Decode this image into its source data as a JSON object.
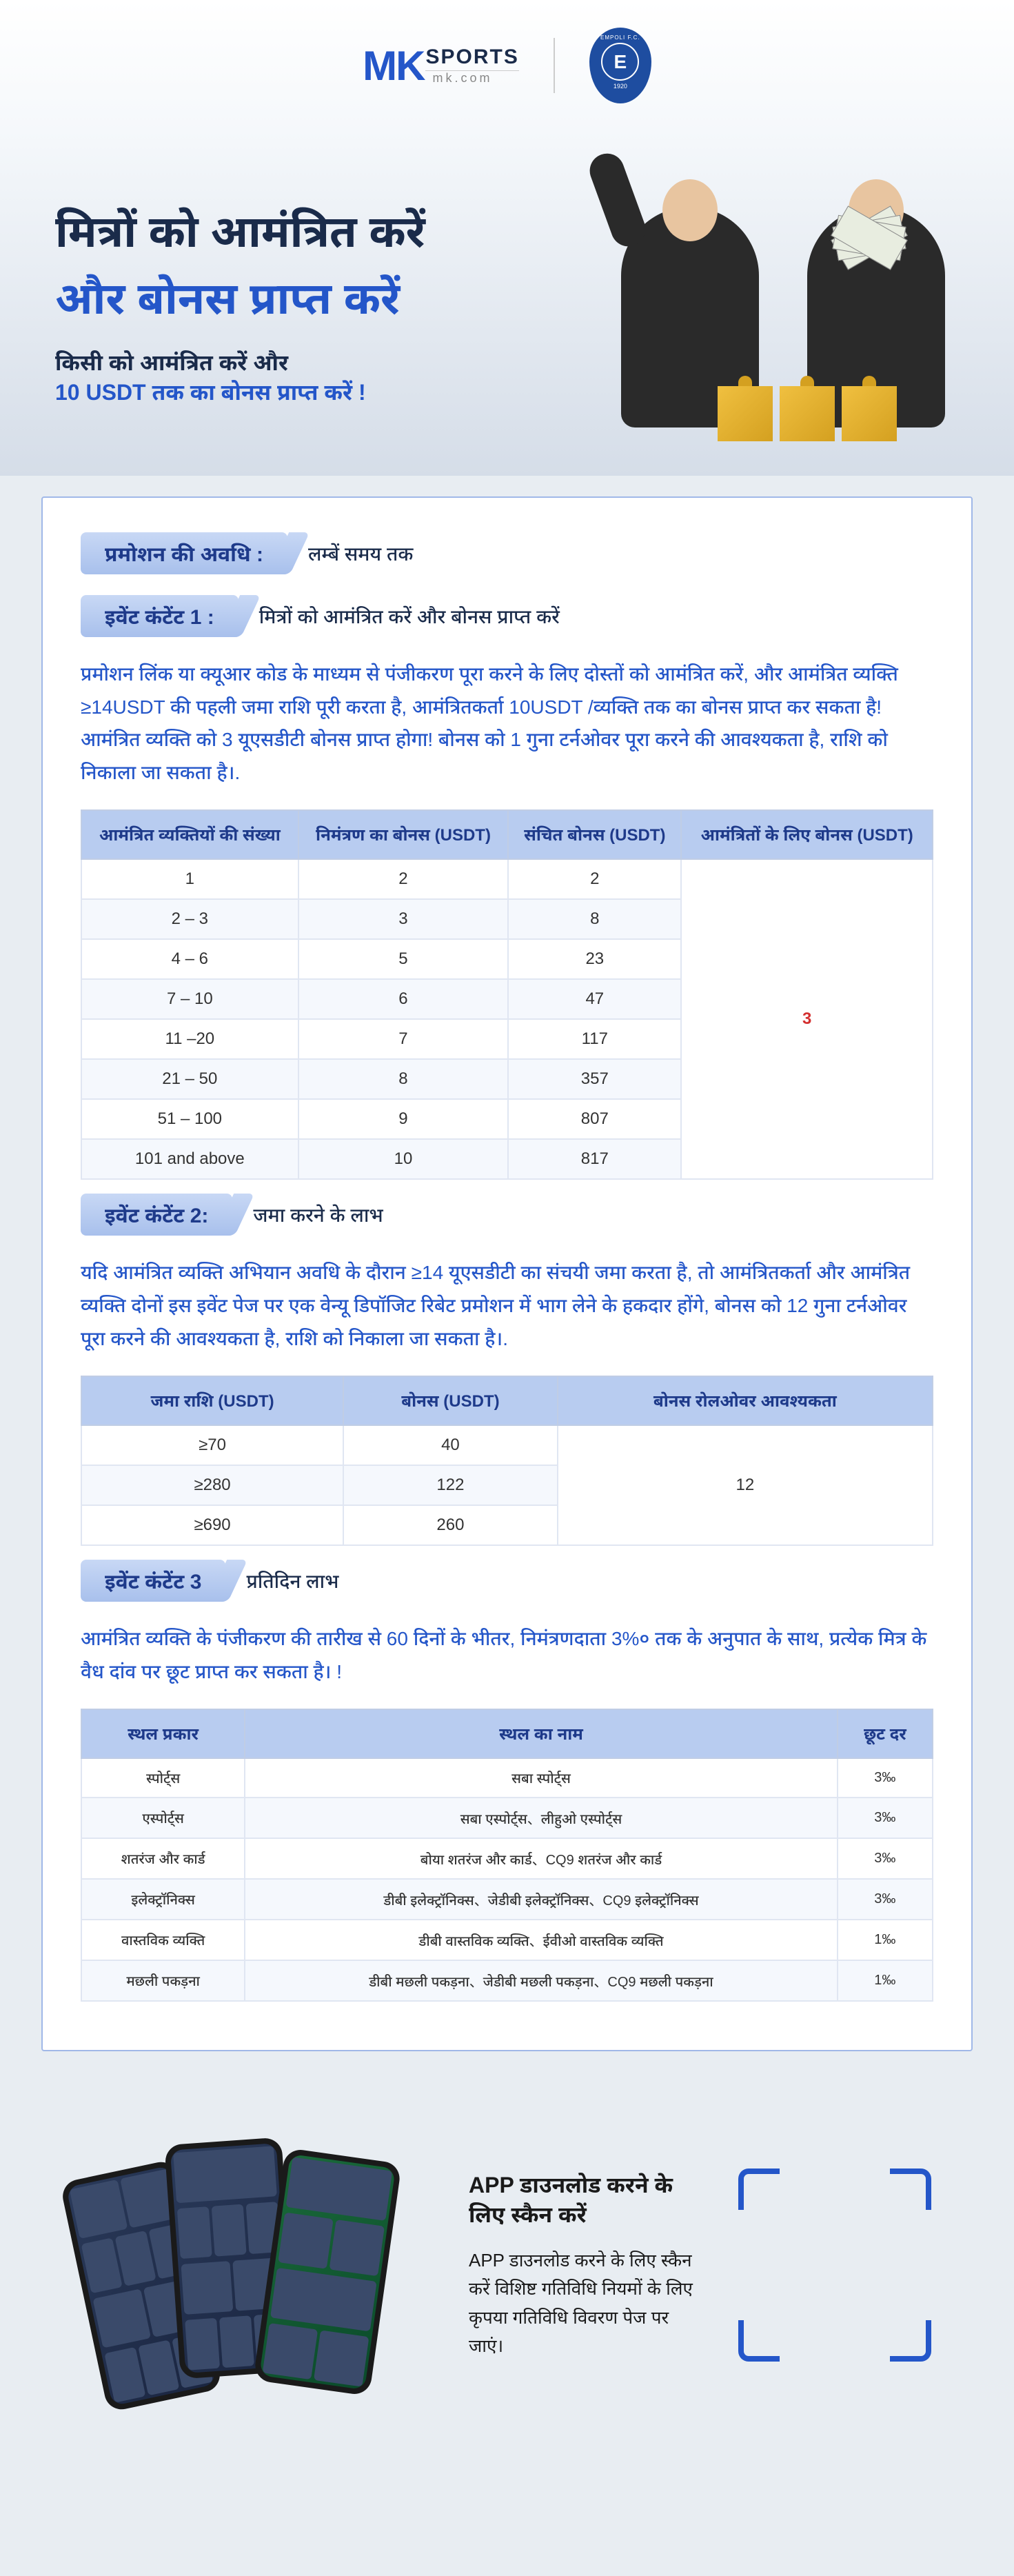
{
  "header": {
    "logo_mk": "MK",
    "logo_sports": "SPORTS",
    "logo_domain": "mk.com",
    "club_top": "EMPOLI F.C.",
    "club_letter": "E",
    "club_year": "1920"
  },
  "hero": {
    "title1": "मित्रों को आमंत्रित करें",
    "title2": "और बोनस प्राप्त करें",
    "sub1": "किसी को आमंत्रित करें और",
    "sub2": "10 USDT तक का बोनस प्राप्त करें !"
  },
  "promotion_period": {
    "label": "प्रमोशन की अवधि :",
    "value": "लम्बें समय तक"
  },
  "event1": {
    "label": "इवेंट कंटेंट 1 :",
    "value": "मित्रों को आमंत्रित करें और बोनस प्राप्त करें",
    "body": "प्रमोशन लिंक या क्यूआर कोड के माध्यम से पंजीकरण पूरा करने के लिए दोस्तों को आमंत्रित करें, और आमंत्रित व्यक्ति ≥14USDT की पहली जमा राशि पूरी करता है, आमंत्रितकर्ता 10USDT /व्यक्ति तक का बोनस प्राप्त कर सकता है! आमंत्रित व्यक्ति को 3 यूएसडीटी बोनस प्राप्त होगा! बोनस को 1 गुना टर्नओवर पूरा करने की आवश्यकता है, राशि को निकाला जा सकता है।.",
    "table": {
      "headers": [
        "आमंत्रित व्यक्तियों की संख्या",
        "निमंत्रण का बोनस  (USDT)",
        "संचित बोनस  (USDT)",
        "आमंत्रितों के लिए बोनस  (USDT)"
      ],
      "rows": [
        [
          "1",
          "2",
          "2"
        ],
        [
          "2 – 3",
          "3",
          "8"
        ],
        [
          "4 – 6",
          "5",
          "23"
        ],
        [
          "7 – 10",
          "6",
          "47"
        ],
        [
          "11 –20",
          "7",
          "117"
        ],
        [
          "21 – 50",
          "8",
          "357"
        ],
        [
          "51 – 100",
          "9",
          "807"
        ],
        [
          "101 and above",
          "10",
          "817"
        ]
      ],
      "merged_last": "3"
    }
  },
  "event2": {
    "label": "इवेंट कंटेंट 2:",
    "value": "जमा करने के लाभ",
    "body": "यदि आमंत्रित व्यक्ति अभियान अवधि के दौरान ≥14 यूएसडीटी का संचयी जमा करता है, तो आमंत्रितकर्ता और आमंत्रित व्यक्ति दोनों इस इवेंट पेज पर एक वेन्यू डिपॉजिट रिबेट प्रमोशन में भाग लेने के हकदार होंगे, बोनस को 12 गुना टर्नओवर पूरा करने की आवश्यकता है, राशि को निकाला जा सकता है।.",
    "table": {
      "headers": [
        "जमा राशि  (USDT)",
        "बोनस  (USDT)",
        "बोनस रोलओवर आवश्यकता"
      ],
      "rows": [
        [
          "≥70",
          "40"
        ],
        [
          "≥280",
          "122"
        ],
        [
          "≥690",
          "260"
        ]
      ],
      "merged_last": "12"
    }
  },
  "event3": {
    "label": "इवेंट कंटेंट 3",
    "value": "प्रतिदिन लाभ",
    "body": "आमंत्रित व्यक्ति के पंजीकरण की तारीख से 60 दिनों के भीतर, निमंत्रणदाता 3%० तक के अनुपात के साथ, प्रत्येक मित्र के वैध दांव पर छूट प्राप्त कर सकता है। !",
    "table": {
      "headers": [
        "स्थल प्रकार",
        "स्थल का नाम",
        "छूट दर"
      ],
      "rows": [
        [
          "स्पोर्ट्स",
          "सबा स्पोर्ट्स",
          "3‰"
        ],
        [
          "एस्पोर्ट्स",
          "सबा एस्पोर्ट्स、लीहुओ एस्पोर्ट्स",
          "3‰"
        ],
        [
          "शतरंज और कार्ड",
          "बोया शतरंज और कार्ड、CQ9 शतरंज और कार्ड",
          "3‰"
        ],
        [
          "इलेक्ट्रॉनिक्स",
          "डीबी इलेक्ट्रॉनिक्स、जेडीबी इलेक्ट्रॉनिक्स、CQ9 इलेक्ट्रॉनिक्स",
          "3‰"
        ],
        [
          "वास्तविक व्यक्ति",
          "डीबी वास्तविक व्यक्ति、ईवीओ वास्तविक व्यक्ति",
          "1‰"
        ],
        [
          "मछली पकड़ना",
          "डीबी मछली पकड़ना、जेडीबी मछली पकड़ना、CQ9 मछली पकड़ना",
          "1‰"
        ]
      ]
    }
  },
  "footer": {
    "title": "APP  डाउनलोड करने के लिए स्कैन करें",
    "body": "APP  डाउनलोड करने के लिए स्कैन करें विशिष्ट गतिविधि नियमों के लिए कृपया गतिविधि विवरण पेज पर जाएं।"
  }
}
